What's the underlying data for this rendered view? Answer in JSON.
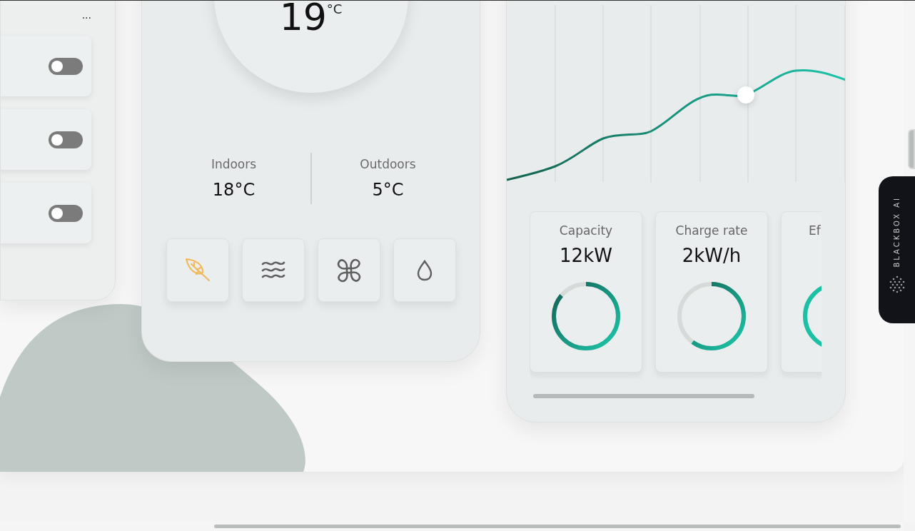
{
  "more_menu": {
    "label": "..."
  },
  "toggles": [
    {
      "on": false
    },
    {
      "on": false
    },
    {
      "on": false
    }
  ],
  "thermostat": {
    "temperature": "19",
    "unit": "°C",
    "readings": [
      {
        "label": "Indoors",
        "value": "18°C"
      },
      {
        "label": "Outdoors",
        "value": "5°C"
      }
    ],
    "modes": [
      {
        "kind": "leaf",
        "selected": true
      },
      {
        "kind": "waves",
        "selected": false
      },
      {
        "kind": "fan",
        "selected": false
      },
      {
        "kind": "drop",
        "selected": false
      }
    ]
  },
  "energy": {
    "stats": [
      {
        "label": "Capacity",
        "value": "12kW",
        "level": 0.86
      },
      {
        "label": "Charge rate",
        "value": "2kW/h",
        "level": 0.6
      },
      {
        "label": "Ef"
      }
    ]
  },
  "extension_tab": {
    "label": "BLACKBOX AI"
  }
}
